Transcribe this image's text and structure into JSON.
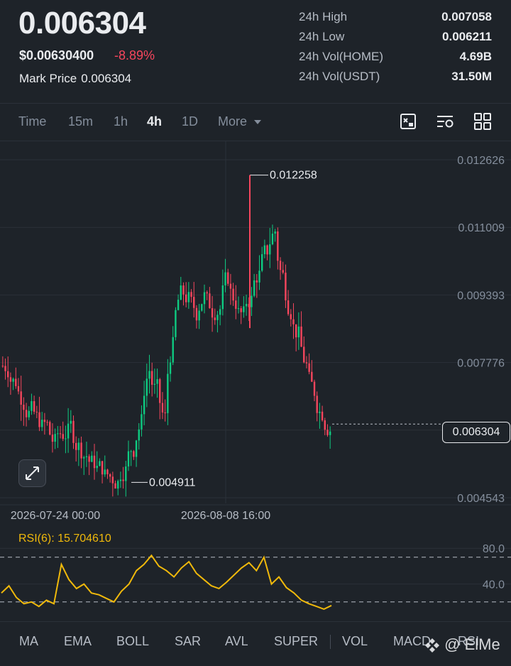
{
  "header": {
    "last_price": "0.006304",
    "usd_price": "$0.00630400",
    "change_pct": "-8.89%",
    "mark_label": "Mark Price",
    "mark_value": "0.006304"
  },
  "stats": [
    {
      "label": "24h High",
      "value": "0.007058"
    },
    {
      "label": "24h Low",
      "value": "0.006211"
    },
    {
      "label": "24h Vol(HOME)",
      "value": "4.69B"
    },
    {
      "label": "24h Vol(USDT)",
      "value": "31.50M"
    }
  ],
  "timeframes": {
    "time": "Time",
    "m15": "15m",
    "h1": "1h",
    "h4": "4h",
    "d1": "1D",
    "more": "More",
    "active": "4h"
  },
  "icons": [
    "chart-type-icon",
    "indicator-settings-icon",
    "layout-grid-icon",
    "expand-icon",
    "caret-down-icon",
    "binance-logo-icon"
  ],
  "colors": {
    "up": "#0ecb81",
    "down": "#f6465d",
    "rsi": "#f0b90b",
    "background": "#1e2329"
  },
  "chart_data": {
    "type": "candlestick",
    "y_ticks": [
      "0.012626",
      "0.011009",
      "0.009393",
      "0.007776",
      "0.006304",
      "0.004543"
    ],
    "ylim": [
      0.004543,
      0.012626
    ],
    "x_ticks": [
      "2026-07-24 00:00",
      "2026-08-08 16:00"
    ],
    "high_label": "0.012258",
    "low_label": "0.004911",
    "current_price_label": "0.006304",
    "series": [
      {
        "name": "close",
        "values": [
          0.0077,
          0.0073,
          0.0069,
          0.0066,
          0.0063,
          0.0062,
          0.0058,
          0.0061,
          0.0062,
          0.0058,
          0.0056,
          0.0053,
          0.0052,
          0.005,
          0.005,
          0.0054,
          0.0058,
          0.0065,
          0.0078,
          0.007,
          0.0063,
          0.0085,
          0.0095,
          0.0093,
          0.0089,
          0.0095,
          0.009,
          0.0092,
          0.0098,
          0.0092,
          0.0088,
          0.0094,
          0.01,
          0.0104,
          0.011,
          0.0097,
          0.0091,
          0.0084,
          0.0076,
          0.0069,
          0.0066,
          0.0063
        ]
      }
    ]
  },
  "rsi": {
    "label": "RSI(6): 15.704610",
    "y_ticks": [
      "80.0",
      "40.0"
    ],
    "ylim": [
      0,
      100
    ],
    "values": [
      30,
      38,
      25,
      18,
      20,
      15,
      22,
      18,
      62,
      45,
      35,
      40,
      30,
      28,
      24,
      20,
      32,
      40,
      55,
      62,
      72,
      60,
      55,
      48,
      58,
      65,
      52,
      45,
      38,
      35,
      42,
      50,
      58,
      64,
      55,
      70,
      40,
      48,
      36,
      30,
      22,
      18,
      15,
      12,
      16
    ]
  },
  "indicators": [
    "MA",
    "EMA",
    "BOLL",
    "SAR",
    "AVL",
    "SUPER",
    "VOL",
    "MACD",
    "RSI"
  ],
  "watermark": "@ ElMe"
}
